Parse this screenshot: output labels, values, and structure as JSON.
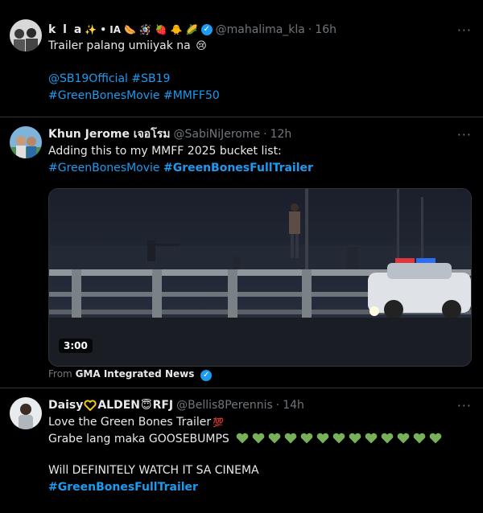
{
  "tweets": [
    {
      "name": "k l a",
      "name_emojis": "✨ • IA 🌭 🪅 🍓 🐥 🌽",
      "handle": "@mahalima_kla",
      "time": "16h",
      "text1": "Trailer palang umiiyak na",
      "text1_emoji": "😢",
      "mentions": "@SB19Official #SB19",
      "tags": "#GreenBonesMovie #MMFF50",
      "more": "···"
    },
    {
      "name": "Khun Jerome เจอโรม",
      "handle": "@SabiNiJerome",
      "time": "12h",
      "text1": "Adding this to my MMFF 2025 bucket list:",
      "tag_plain": "#GreenBonesMovie",
      "tag_bold": "#GreenBonesFullTrailer",
      "video_duration": "3:00",
      "from_label": "From",
      "from_source": "GMA Integrated News",
      "more": "···"
    },
    {
      "name_part1": "Daisy",
      "name_part2": "ALDEN",
      "name_part3": "RFJ",
      "handle": "@Bellis8Perennis",
      "time": "14h",
      "text1": "Love the Green Bones Trailer",
      "text1_emoji": "💯",
      "text2": "Grabe lang maka GOOSEBUMPS",
      "heart_count": 13,
      "text3": "Will DEFINITELY WATCH IT SA CINEMA",
      "tag_bold": "#GreenBonesFullTrailer",
      "more": "···"
    }
  ],
  "colors": {
    "link": "#1d9bf0",
    "muted": "#71767b",
    "text": "#e7e9ea",
    "heart": "#78b159"
  }
}
